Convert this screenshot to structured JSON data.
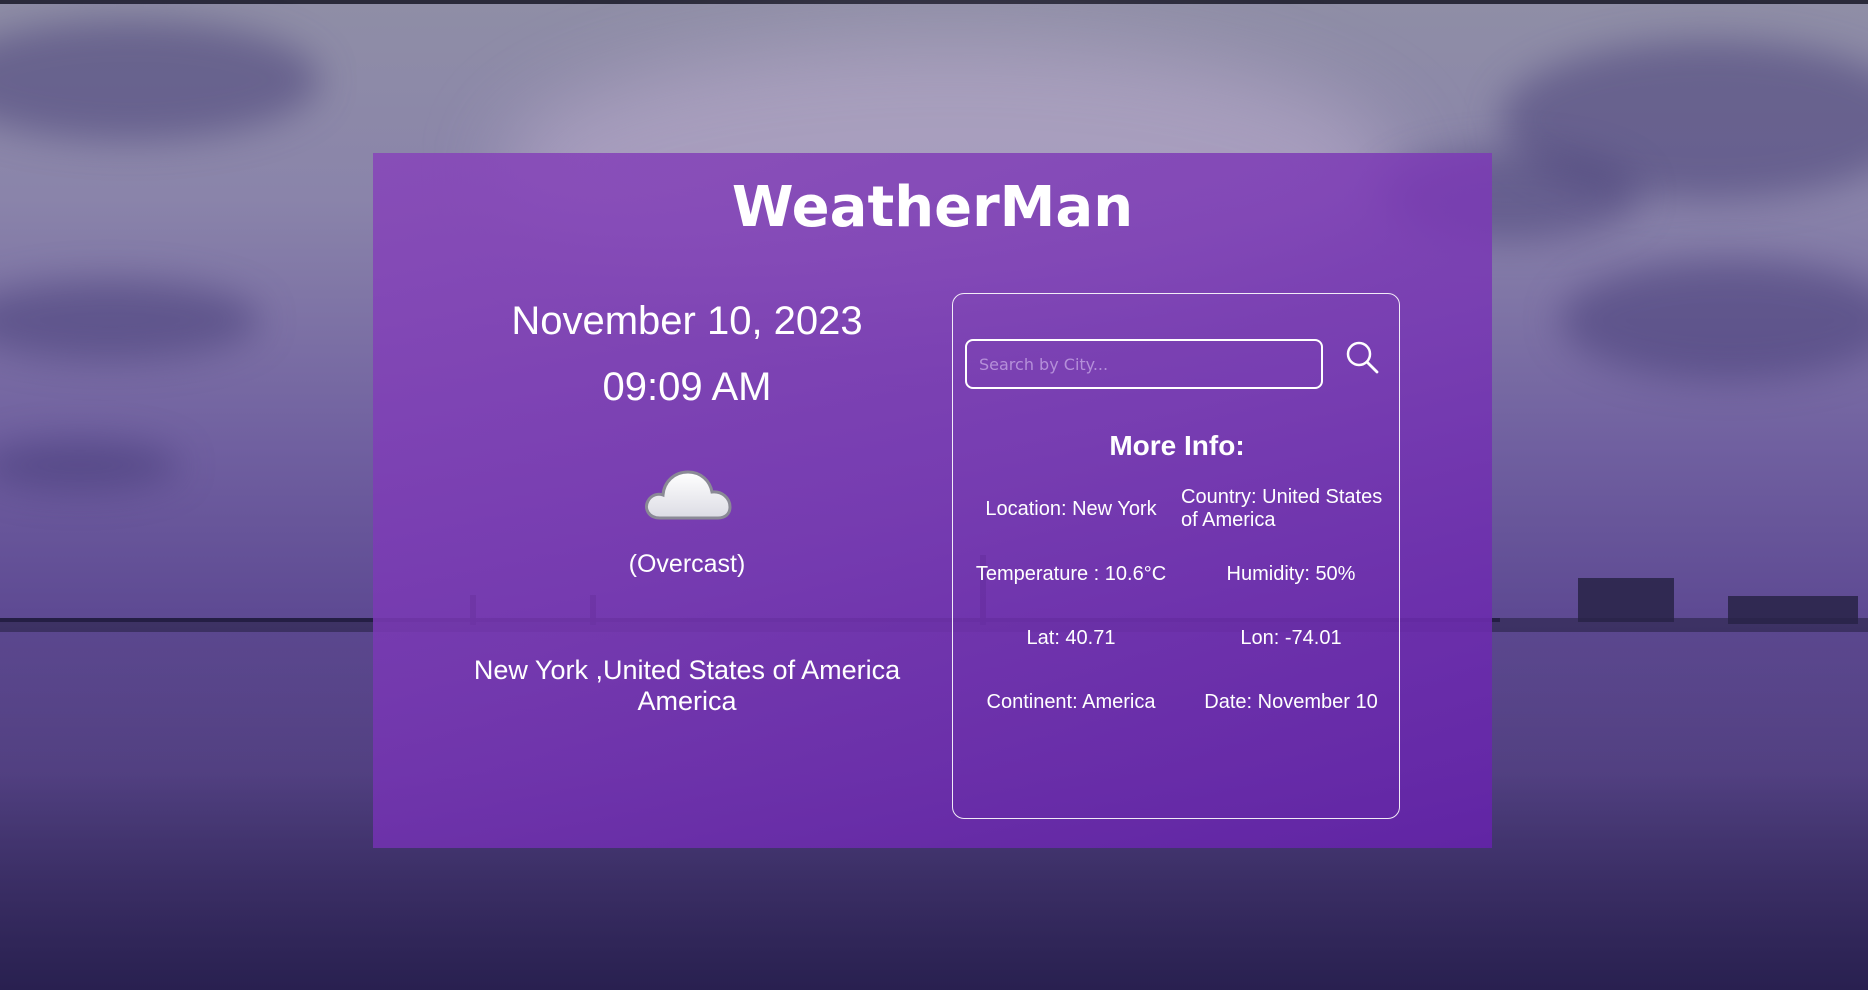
{
  "app": {
    "title": "WeatherMan"
  },
  "current": {
    "date": "November 10, 2023",
    "time": "09:09 AM",
    "icon": "cloud-icon",
    "condition": "(Overcast)",
    "place_line1": "New York ,United States of America",
    "place_line2": "America"
  },
  "search": {
    "placeholder": "Search by City...",
    "value": "",
    "button_icon": "search-icon"
  },
  "more_info": {
    "heading": "More Info:",
    "location": "Location: New York",
    "country": "Country: United States of America",
    "temperature": "Temperature : 10.6°C",
    "humidity": "Humidity: 50%",
    "lat": "Lat: 40.71",
    "lon": "Lon: -74.01",
    "continent": "Continent: America",
    "date": "Date: November 10"
  },
  "colors": {
    "card": "#8a46c0",
    "text": "#ffffff"
  }
}
